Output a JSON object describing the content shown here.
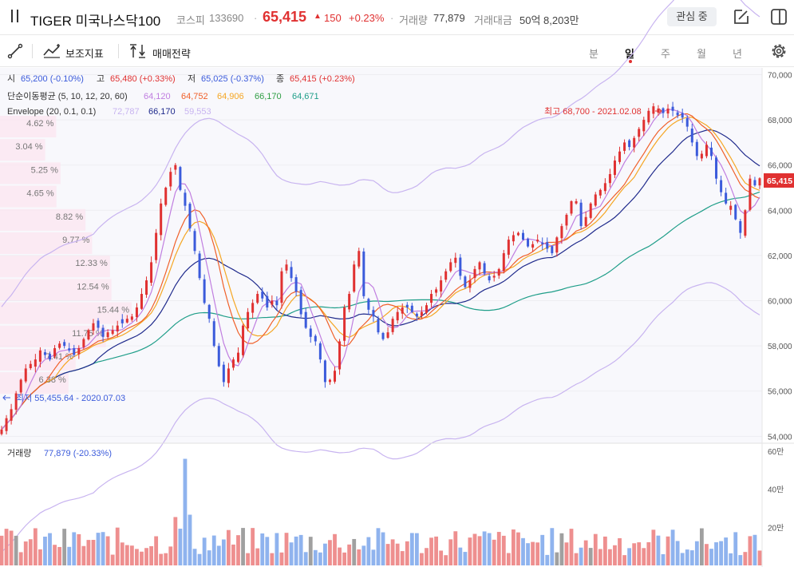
{
  "header": {
    "name": "TIGER 미국나스닥100",
    "market": "코스피",
    "code": "133690",
    "price": "65,415",
    "change_arrow": "▲",
    "change": "150",
    "change_pct": "+0.23%",
    "dot": "·",
    "volume_label": "거래량",
    "volume": "77,879",
    "value_label": "거래대금",
    "value": "50억 8,203만",
    "watch_label": "관심 중"
  },
  "toolbar": {
    "indicators": "보조지표",
    "strategy": "매매전략",
    "periods": [
      "분",
      "일",
      "주",
      "월",
      "년"
    ],
    "active_period": "일"
  },
  "legend": {
    "o_label": "시",
    "o_value": "65,200 (-0.10%)",
    "h_label": "고",
    "h_value": "65,480 (+0.33%)",
    "l_label": "저",
    "l_value": "65,025 (-0.37%)",
    "c_label": "종",
    "c_value": "65,415 (+0.23%)",
    "ma_label": "단순이동평균 (5, 10, 12, 20, 60)",
    "ma_values": [
      "64,120",
      "64,752",
      "64,906",
      "66,170",
      "64,671"
    ],
    "env_label": "Envelope (20, 0.1, 0.1)",
    "env_values": [
      "72,787",
      "66,170",
      "59,553"
    ],
    "vol_label": "거래량",
    "vol_value": "77,879 (-20.33%)"
  },
  "annotations": {
    "high": "최고 68,700 - 2021.02.08",
    "low": "최저 55,455.64 - 2020.07.03"
  },
  "price_axis": [
    "70,000",
    "68,000",
    "66,000",
    "64,000",
    "62,000",
    "60,000",
    "58,000",
    "56,000",
    "54,000"
  ],
  "last_price_tag": "65,415",
  "volume_axis": [
    "60만",
    "40만",
    "20만"
  ],
  "volume_profile": [
    "4.62 %",
    "3.04 %",
    "5.25 %",
    "4.65 %",
    "8.82 %",
    "9.77 %",
    "12.33 %",
    "12.54 %",
    "15.44 %",
    "11.75 %",
    "7.41 %",
    "6.38 %"
  ],
  "colors": {
    "up": "#e03131",
    "down": "#3b5bdb",
    "ma5": "#c07ee0",
    "ma10": "#f0602a",
    "ma12": "#f5a623",
    "ma20": "#1f2a8c",
    "ma60": "#1f9e89",
    "envelope": "#c8b4f0",
    "vol_up": "#ee8f8f",
    "vol_down": "#8fb3ee",
    "vol_flat": "#a0a0a0"
  },
  "chart_data": {
    "type": "candlestick",
    "y_range": [
      53800,
      70300
    ],
    "volume_max": 600000,
    "closes": [
      54300,
      54800,
      55200,
      55900,
      56500,
      57000,
      57200,
      57400,
      57800,
      57600,
      57400,
      57900,
      58100,
      58000,
      57800,
      57600,
      57900,
      58300,
      58700,
      59000,
      58800,
      58400,
      58600,
      58700,
      58900,
      59000,
      59200,
      59300,
      59700,
      60300,
      60900,
      61700,
      63000,
      64300,
      65000,
      65700,
      66000,
      64900,
      64200,
      63200,
      62200,
      61000,
      59900,
      59200,
      58000,
      57100,
      56400,
      57000,
      57400,
      57700,
      58900,
      59500,
      59900,
      60300,
      60100,
      59700,
      60000,
      59800,
      61300,
      61600,
      61000,
      60400,
      59400,
      58800,
      58400,
      58200,
      57400,
      56400,
      56500,
      56900,
      58200,
      59700,
      60300,
      61600,
      62200,
      60200,
      59600,
      59300,
      58600,
      58300,
      58600,
      59200,
      59500,
      59700,
      59700,
      59500,
      59300,
      59500,
      59800,
      60300,
      60500,
      60900,
      61300,
      61700,
      61900,
      61100,
      60600,
      60900,
      61400,
      61700,
      61200,
      60900,
      61100,
      61400,
      62100,
      62700,
      62900,
      63000,
      62700,
      62400,
      62500,
      62700,
      62500,
      62300,
      62100,
      62800,
      63300,
      63800,
      64400,
      64400,
      63300,
      63700,
      64300,
      64700,
      64900,
      65200,
      65600,
      66200,
      66600,
      67000,
      66800,
      67200,
      67600,
      68000,
      68400,
      68600,
      68500,
      68300,
      68500,
      68400,
      68200,
      68100,
      67700,
      67000,
      66400,
      66500,
      66900,
      66400,
      65400,
      64800,
      64300,
      64200,
      63600,
      63000,
      64000,
      65400,
      65100,
      65415
    ]
  }
}
